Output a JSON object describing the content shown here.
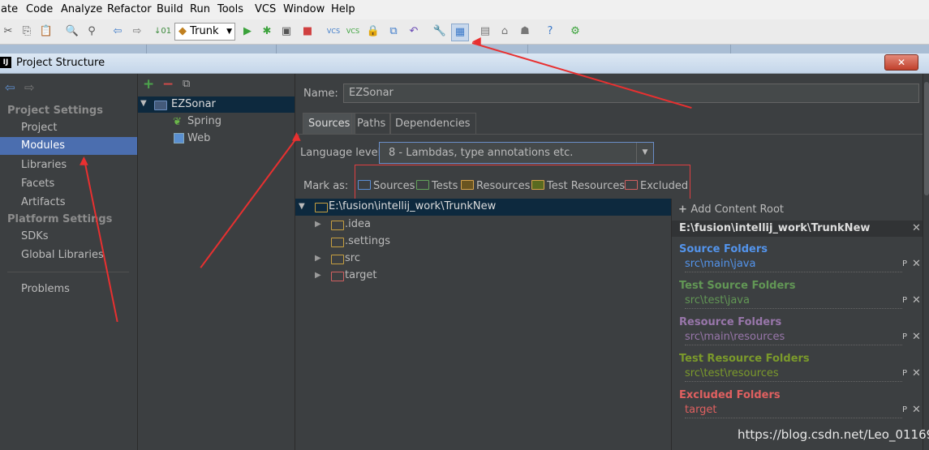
{
  "menu": [
    "ate",
    "Code",
    "Analyze",
    "Refactor",
    "Build",
    "Run",
    "Tools",
    "VCS",
    "Window",
    "Help"
  ],
  "toolbar": {
    "branch": "Trunk"
  },
  "dialog": {
    "title": "Project Structure",
    "close": "✕"
  },
  "left": {
    "project_settings": "Project Settings",
    "items": [
      "Project",
      "Modules",
      "Libraries",
      "Facets",
      "Artifacts"
    ],
    "platform_settings": "Platform Settings",
    "platform_items": [
      "SDKs",
      "Global Libraries"
    ],
    "problems": "Problems"
  },
  "modules": {
    "root": "EZSonar",
    "children": [
      "Spring",
      "Web"
    ]
  },
  "detail": {
    "name_label": "Name:",
    "name_value": "EZSonar",
    "tabs": [
      "Sources",
      "Paths",
      "Dependencies"
    ],
    "lang_label": "Language level:",
    "lang_value": "8 - Lambdas, type annotations etc.",
    "mark_label": "Mark as:",
    "marks": [
      "Sources",
      "Tests",
      "Resources",
      "Test Resources",
      "Excluded"
    ],
    "tree_root": "E:\\fusion\\intellij_work\\TrunkNew",
    "tree_items": [
      ".idea",
      ".settings",
      "src",
      "target"
    ]
  },
  "roots": {
    "add": "Add Content Root",
    "path": "E:\\fusion\\intellij_work\\TrunkNew",
    "groups": [
      {
        "title": "Source Folders",
        "path": "src\\main\\java",
        "color": "#5394ec"
      },
      {
        "title": "Test Source Folders",
        "path": "src\\test\\java",
        "color": "#629755"
      },
      {
        "title": "Resource Folders",
        "path": "src\\main\\resources",
        "color": "#9876aa"
      },
      {
        "title": "Test Resource Folders",
        "path": "src\\test\\resources",
        "color": "#7b9a2b"
      },
      {
        "title": "Excluded Folders",
        "path": "target",
        "color": "#e06060"
      }
    ]
  },
  "watermark": "https://blog.csdn.net/Leo_01169"
}
